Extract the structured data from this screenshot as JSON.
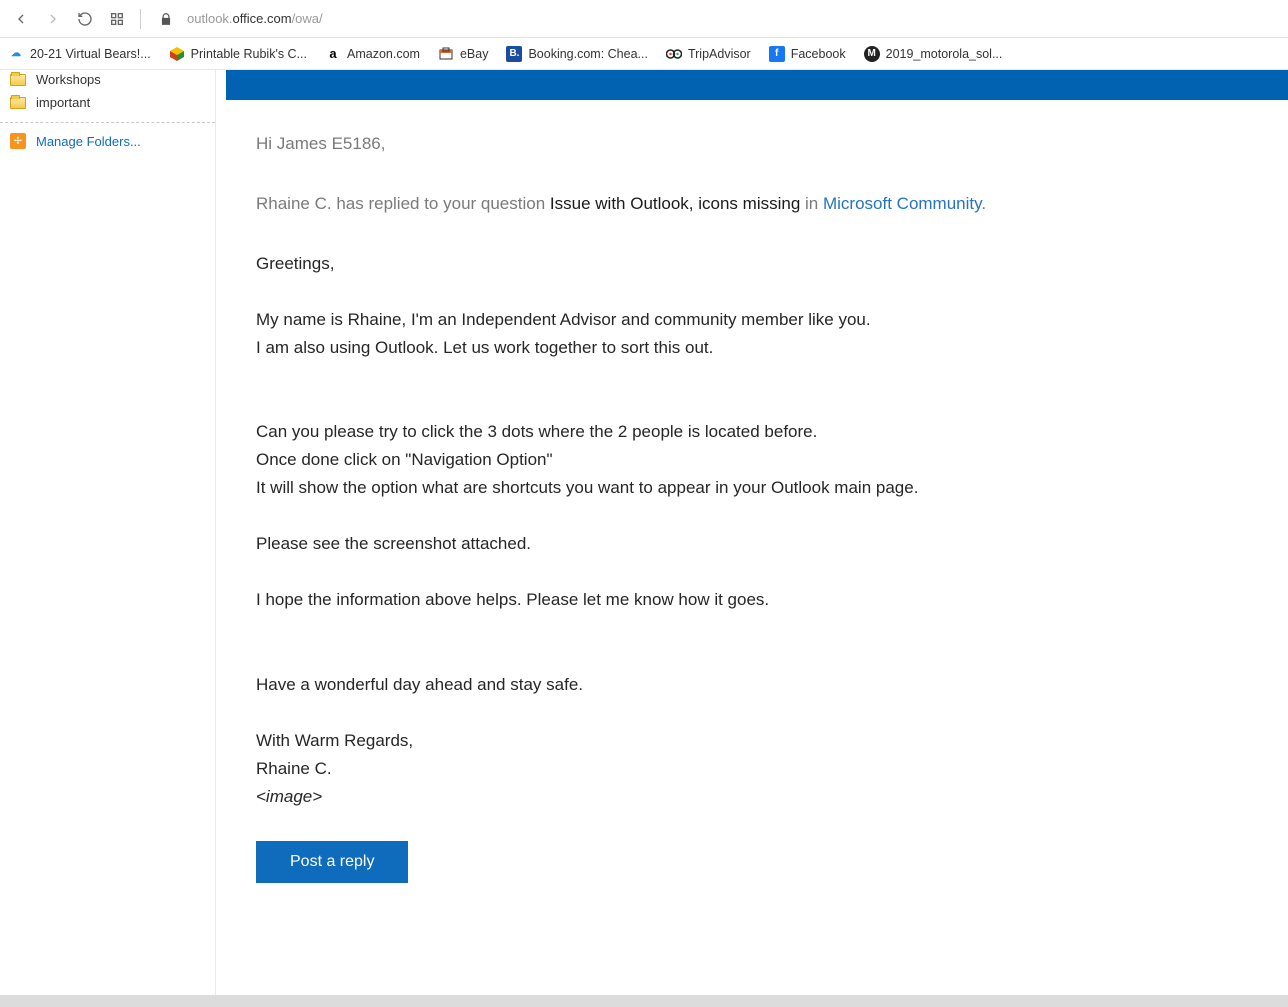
{
  "browser": {
    "url_muted_prefix": "outlook.",
    "url_main": "office.com",
    "url_path": "/owa/"
  },
  "bookmarks": [
    {
      "label": "20-21 Virtual Bears!..."
    },
    {
      "label": "Printable Rubik's C..."
    },
    {
      "label": "Amazon.com"
    },
    {
      "label": "eBay"
    },
    {
      "label": "Booking.com: Chea..."
    },
    {
      "label": "TripAdvisor"
    },
    {
      "label": "Facebook"
    },
    {
      "label": "2019_motorola_sol..."
    }
  ],
  "sidebar": {
    "folders": [
      {
        "label": "Workshops"
      },
      {
        "label": "important"
      }
    ],
    "manage": "Manage Folders..."
  },
  "message": {
    "greeting": "Hi James E5186,",
    "intro_prefix": "Rhaine C. has replied to your question ",
    "intro_subject": "Issue with Outlook, icons missing",
    "intro_in": " in ",
    "intro_link": "Microsoft Community",
    "period": ".",
    "greet2": "Greetings,",
    "p1_l1": "My name is Rhaine, I'm an Independent Advisor and community member like you.",
    "p1_l2": "I am also using Outlook. Let us work together to sort this out.",
    "p2_l1": "Can you please try to click the 3 dots where the 2 people is located before.",
    "p2_l2": "Once done click on \"Navigation Option\"",
    "p2_l3": "It will show the option what are shortcuts you want to appear in your Outlook main page.",
    "p3": "Please see the screenshot attached.",
    "p4": "I hope the information above helps. Please let me know how it goes.",
    "p5": "Have a wonderful day ahead and stay safe.",
    "sign1": "With Warm Regards,",
    "sign2": "Rhaine C.",
    "image_ph": "<image>",
    "reply_btn": "Post a reply"
  }
}
